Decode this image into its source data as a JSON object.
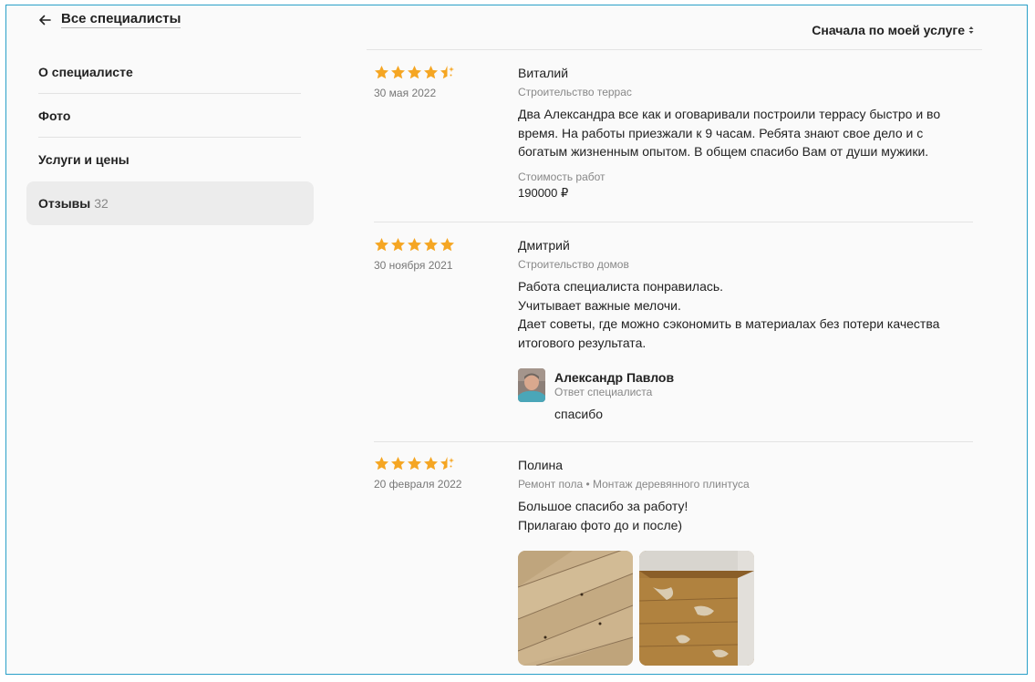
{
  "header": {
    "back_label": "Все специалисты",
    "sort_label": "Сначала по моей услуге"
  },
  "nav": {
    "items": [
      {
        "label": "О специалисте"
      },
      {
        "label": "Фото"
      },
      {
        "label": "Услуги и цены"
      },
      {
        "label": "Отзывы",
        "count": "32",
        "active": true
      }
    ]
  },
  "colors": {
    "star": "#f5a623",
    "accent_border": "#2aa0c8",
    "active_nav_bg": "#ececec"
  },
  "reviews": [
    {
      "rating": 4.5,
      "date": "30 мая 2022",
      "author": "Виталий",
      "service": "Строительство террас",
      "text_lines": [
        "Два Александра все как и оговаривали построили террасу быстро и во",
        "время. На работы приезжали к 9 часам. Ребята знают свое дело и с",
        "богатым жизненным опытом. В общем спасибо Вам от души мужики."
      ],
      "cost_label": "Стоимость работ",
      "cost_value": "190000 ₽"
    },
    {
      "rating": 5,
      "date": "30 ноября 2021",
      "author": "Дмитрий",
      "service": "Строительство домов",
      "text_lines": [
        "Работа специалиста понравилась.",
        "Учитывает важные мелочи.",
        "Дает советы, где можно сэкономить в материалах без потери качества",
        "итогового результата."
      ],
      "reply": {
        "name": "Александр Павлов",
        "role": "Ответ специалиста",
        "text": "спасибо"
      }
    },
    {
      "rating": 4.5,
      "date": "20 февраля 2022",
      "author": "Полина",
      "service": "Ремонт пола • Монтаж деревянного плинтуса",
      "text_lines": [
        "Большое спасибо за работу!",
        "Прилагаю фото до и после)"
      ],
      "photo_count": 2
    }
  ]
}
